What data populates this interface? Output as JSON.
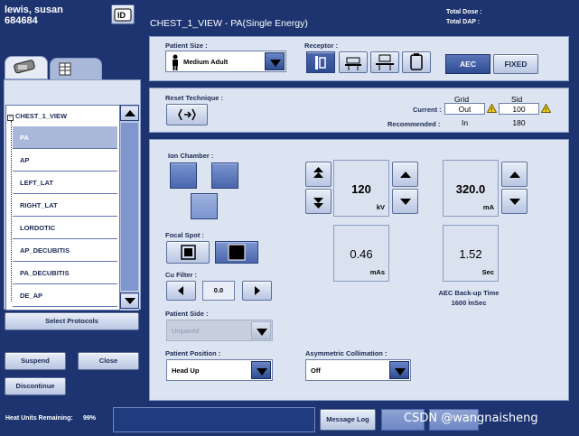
{
  "patient": {
    "name": "lewis, susan",
    "id": "684684"
  },
  "header": {
    "title": "CHEST_1_VIEW - PA(Single Energy)",
    "total_dose_label": "Total Dose :",
    "total_dap_label": "Total DAP :"
  },
  "left": {
    "tree_root": "CHEST_1_VIEW",
    "protocols": [
      "PA",
      "AP",
      "LEFT_LAT",
      "RIGHT_LAT",
      "LORDOTIC",
      "AP_DECUBITIS",
      "PA_DECUBITIS",
      "DE_AP"
    ],
    "selected_protocol": "PA",
    "select_protocols_label": "Select Protocols",
    "suspend_label": "Suspend",
    "close_label": "Close",
    "discontinue_label": "Discontinue"
  },
  "top_panel": {
    "patient_size_label": "Patient Size :",
    "patient_size_value": "Medium Adult",
    "receptor_label": "Receptor :",
    "aec_label": "AEC",
    "fixed_label": "FIXED"
  },
  "reset_panel": {
    "reset_label": "Reset Technique :",
    "grid_header": "Grid",
    "sid_header": "Sid",
    "current_label": "Current :",
    "recommended_label": "Recommended :",
    "grid_current": "Out",
    "grid_recommended": "In",
    "sid_current": "100",
    "sid_recommended": "180"
  },
  "main": {
    "ion_chamber_label": "Ion Chamber :",
    "kv_value": "120",
    "kv_unit": "kV",
    "ma_value": "320.0",
    "ma_unit": "mA",
    "mas_value": "0.46",
    "mas_unit": "mAs",
    "sec_value": "1.52",
    "sec_unit": "Sec",
    "focal_spot_label": "Focal Spot :",
    "cu_filter_label": "Cu Filter :",
    "cu_filter_value": "0.0",
    "aec_backup_label": "AEC Back-up Time :",
    "aec_backup_value": "1600 mSec",
    "patient_side_label": "Patient Side :",
    "patient_side_value": "Unpaired",
    "patient_position_label": "Patient Position :",
    "patient_position_value": "Head Up",
    "asym_label": "Asymmetric Collimation :",
    "asym_value": "Off"
  },
  "footer": {
    "heat_label": "Heat Units Remaining:",
    "heat_value": "99%",
    "message_log_label": "Message Log",
    "watermark": "CSDN @wangnaisheng"
  }
}
